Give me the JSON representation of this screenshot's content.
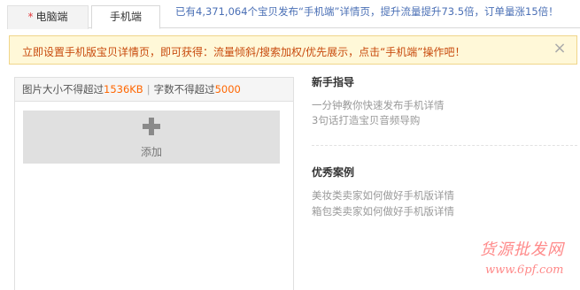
{
  "tabs": {
    "pc": {
      "label": "电脑端",
      "required_mark": "*"
    },
    "mobile": {
      "label": "手机端"
    },
    "notice": "已有4,371,064个宝贝发布“手机端”详情页，提升流量提升73.5倍，订单量涨15倍！"
  },
  "alert": {
    "text": "立即设置手机版宝贝详情页，即可获得：流量倾斜/搜索加权/优先展示，点击“手机端”操作吧！",
    "close_symbol": "×"
  },
  "editor": {
    "image_limit_prefix": "图片大小不得超过",
    "image_limit_value": "1536KB",
    "separator": "|",
    "word_limit_prefix": "字数不得超过",
    "word_limit_value": "5000",
    "add_label": "添加",
    "add_icon": "plus-icon"
  },
  "guide": {
    "title": "新手指导",
    "links": [
      "一分钟教你快速发布手机详情",
      "3句话打造宝贝音频导购"
    ]
  },
  "cases": {
    "title": "优秀案例",
    "links": [
      "美妆类卖家如何做好手机版详情",
      "箱包类卖家如何做好手机版详情"
    ]
  },
  "watermark": {
    "title": "货源批发网",
    "url": "www.6pf.com"
  },
  "colors": {
    "alert_background": "#fff8d8",
    "alert_text": "#c84b0e",
    "notice_text": "#4a6fb5",
    "highlight_number": "#ff6600",
    "watermark": "#ff8a8a"
  }
}
